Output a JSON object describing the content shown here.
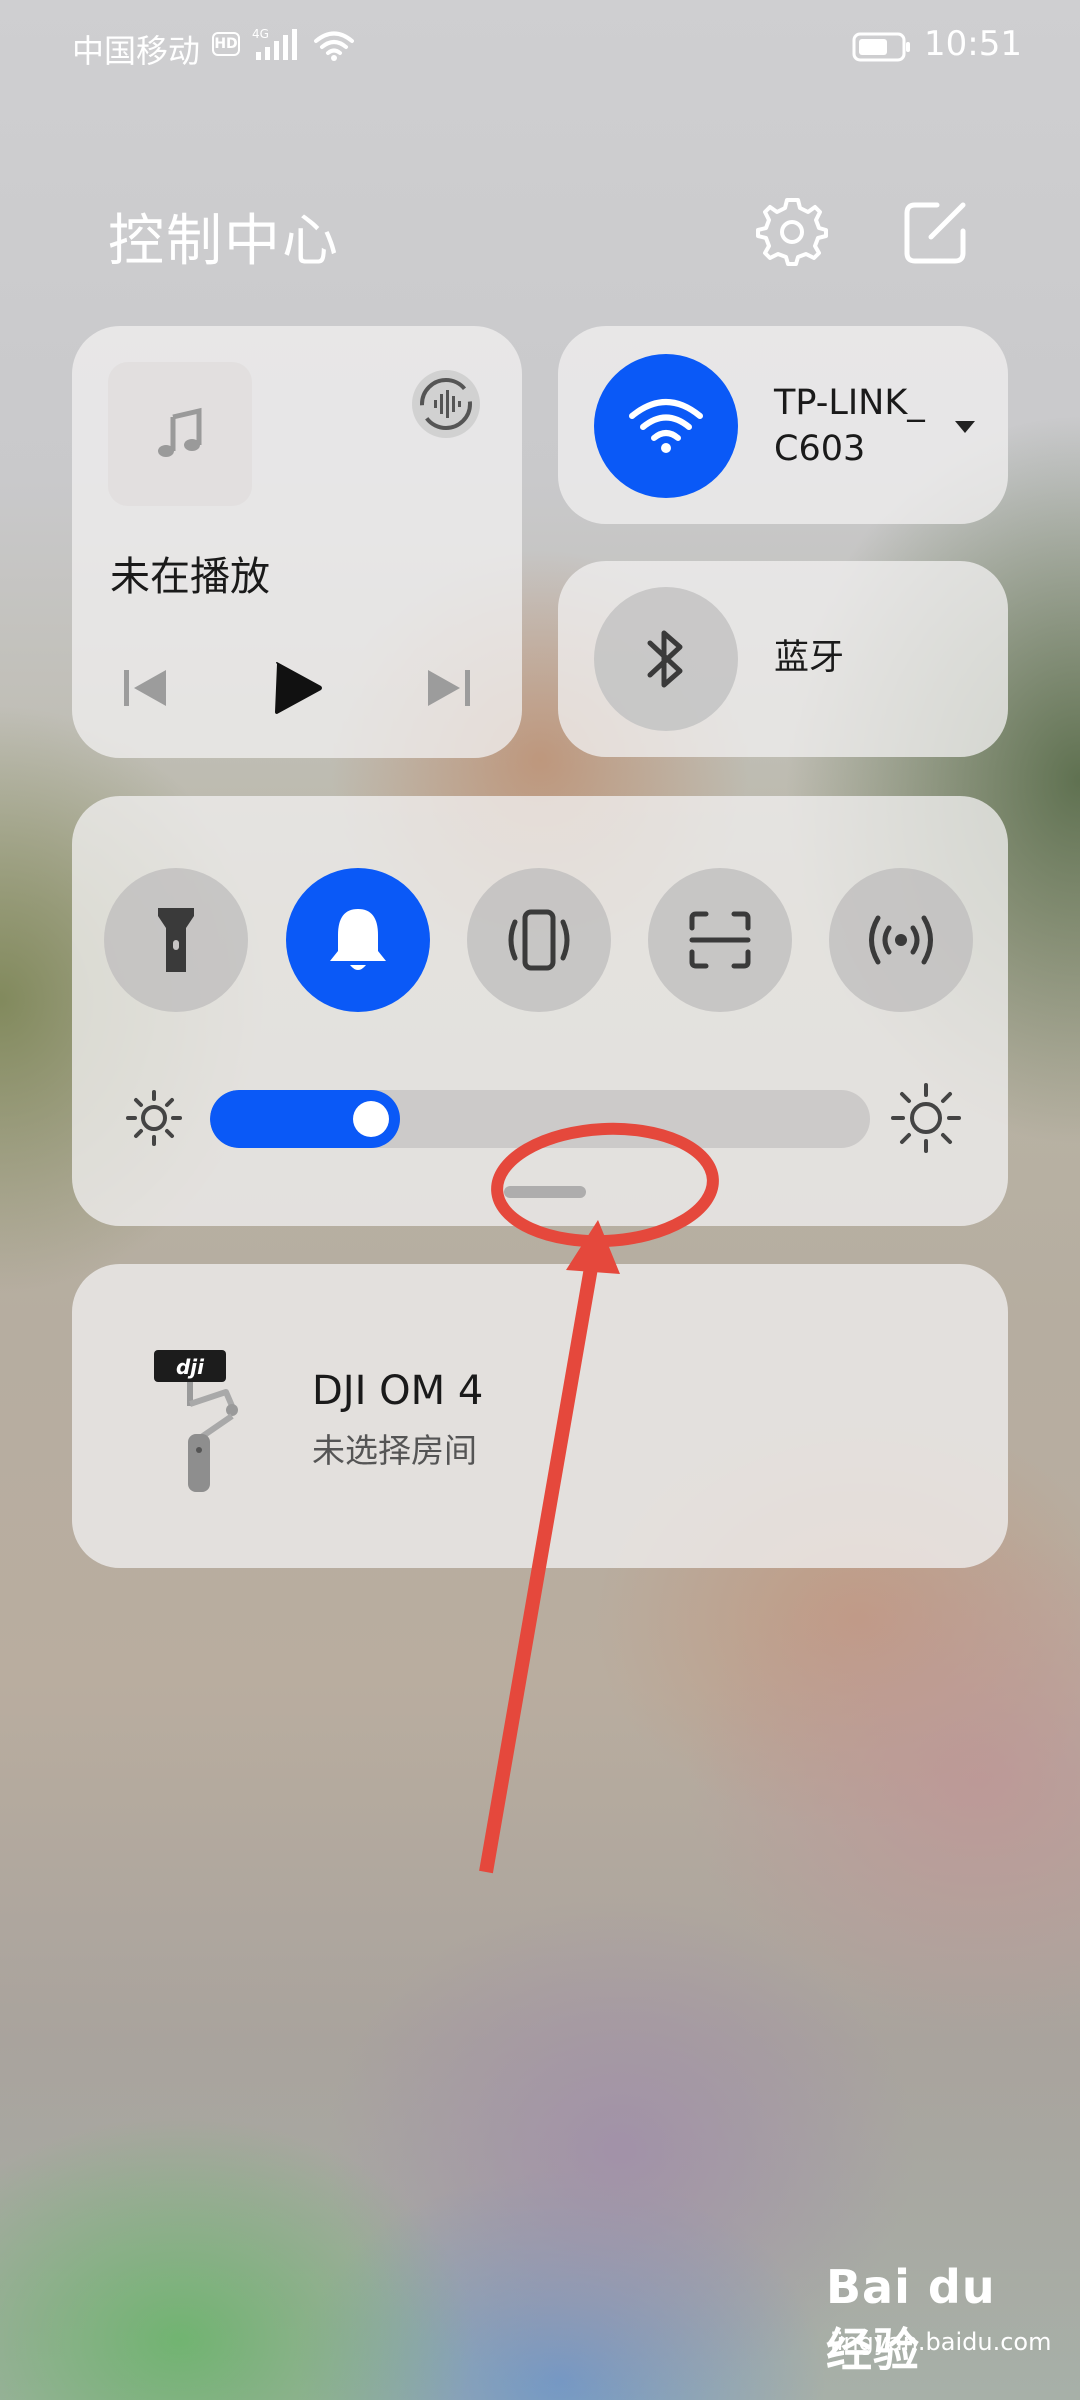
{
  "status_bar": {
    "carrier": "中国移动",
    "hd_badge": "HD",
    "network_type": "4G",
    "time": "10:51"
  },
  "header": {
    "title": "控制中心"
  },
  "media": {
    "status": "未在播放"
  },
  "wifi": {
    "ssid": "TP-LINK_C603",
    "enabled": true
  },
  "bluetooth": {
    "label": "蓝牙",
    "enabled": false
  },
  "toggles": [
    {
      "icon": "flashlight-icon",
      "on": false
    },
    {
      "icon": "bell-icon",
      "on": true
    },
    {
      "icon": "vibrate-icon",
      "on": false
    },
    {
      "icon": "screenshot-icon",
      "on": false
    },
    {
      "icon": "hotspot-icon",
      "on": false
    }
  ],
  "brightness": {
    "level": 0.2
  },
  "device": {
    "name": "DJI OM 4",
    "room": "未选择房间",
    "logo_text": "dji"
  },
  "watermark": {
    "logo": "Bai du 经验",
    "url": "jingyan.baidu.com"
  },
  "colors": {
    "accent": "#0a59f7",
    "annotation": "#e5483c"
  }
}
